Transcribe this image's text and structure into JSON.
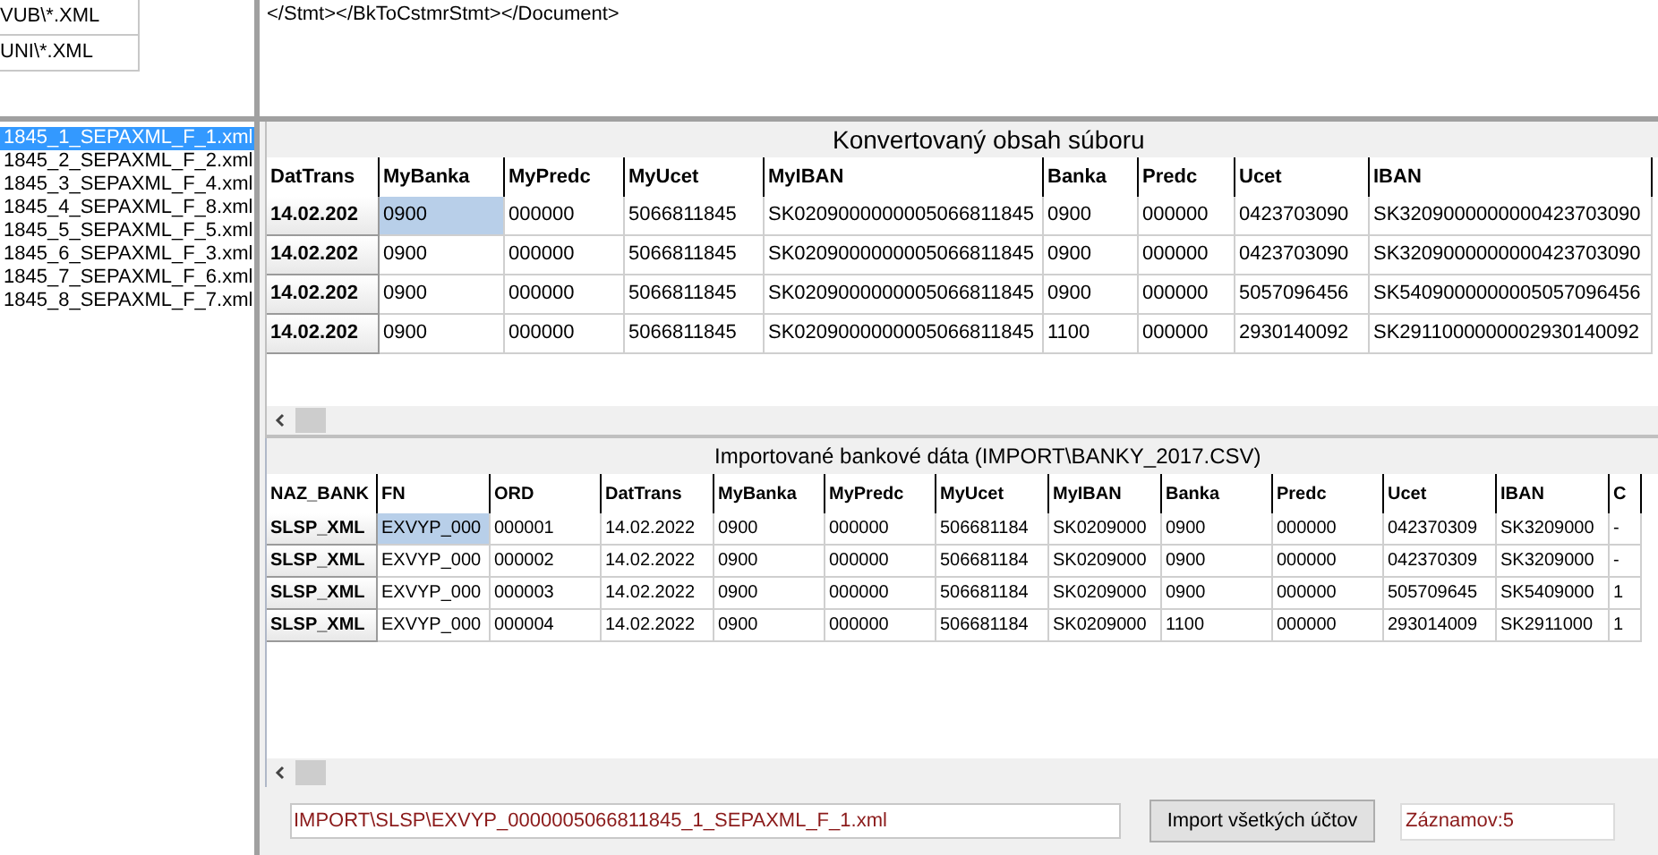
{
  "masks": [
    {
      "text": "VUB\\*.XML"
    },
    {
      "text": "UNI\\*.XML"
    }
  ],
  "xml_preview": {
    "text": "</Stmt></BkToCstmrStmt></Document>"
  },
  "files": [
    {
      "name": "1845_1_SEPAXML_F_1.xml",
      "selected": true
    },
    {
      "name": "1845_2_SEPAXML_F_2.xml",
      "selected": false
    },
    {
      "name": "1845_3_SEPAXML_F_4.xml",
      "selected": false
    },
    {
      "name": "1845_4_SEPAXML_F_8.xml",
      "selected": false
    },
    {
      "name": "1845_5_SEPAXML_F_5.xml",
      "selected": false
    },
    {
      "name": "1845_6_SEPAXML_F_3.xml",
      "selected": false
    },
    {
      "name": "1845_7_SEPAXML_F_6.xml",
      "selected": false
    },
    {
      "name": "1845_8_SEPAXML_F_7.xml",
      "selected": false
    }
  ],
  "converted": {
    "title": "Konvertovaný obsah súboru",
    "columns": [
      "DatTrans",
      "MyBanka",
      "MyPredc",
      "MyUcet",
      "MyIBAN",
      "Banka",
      "Predc",
      "Ucet",
      "IBAN"
    ],
    "rows": [
      {
        "cells": [
          {
            "text": "14.02.202",
            "selected": false
          },
          {
            "text": "0900",
            "selected": true
          },
          {
            "text": "000000",
            "selected": false
          },
          {
            "text": "5066811845",
            "selected": false
          },
          {
            "text": "SK0209000000005066811845",
            "selected": false
          },
          {
            "text": "0900",
            "selected": false
          },
          {
            "text": "000000",
            "selected": false
          },
          {
            "text": "0423703090",
            "selected": false
          },
          {
            "text": "SK3209000000000423703090",
            "selected": false
          }
        ]
      },
      {
        "cells": [
          {
            "text": "14.02.202",
            "selected": false
          },
          {
            "text": "0900",
            "selected": false
          },
          {
            "text": "000000",
            "selected": false
          },
          {
            "text": "5066811845",
            "selected": false
          },
          {
            "text": "SK0209000000005066811845",
            "selected": false
          },
          {
            "text": "0900",
            "selected": false
          },
          {
            "text": "000000",
            "selected": false
          },
          {
            "text": "0423703090",
            "selected": false
          },
          {
            "text": "SK3209000000000423703090",
            "selected": false
          }
        ]
      },
      {
        "cells": [
          {
            "text": "14.02.202",
            "selected": false
          },
          {
            "text": "0900",
            "selected": false
          },
          {
            "text": "000000",
            "selected": false
          },
          {
            "text": "5066811845",
            "selected": false
          },
          {
            "text": "SK0209000000005066811845",
            "selected": false
          },
          {
            "text": "0900",
            "selected": false
          },
          {
            "text": "000000",
            "selected": false
          },
          {
            "text": "5057096456",
            "selected": false
          },
          {
            "text": "SK5409000000005057096456",
            "selected": false
          }
        ]
      },
      {
        "cells": [
          {
            "text": "14.02.202",
            "selected": false
          },
          {
            "text": "0900",
            "selected": false
          },
          {
            "text": "000000",
            "selected": false
          },
          {
            "text": "5066811845",
            "selected": false
          },
          {
            "text": "SK0209000000005066811845",
            "selected": false
          },
          {
            "text": "1100",
            "selected": false
          },
          {
            "text": "000000",
            "selected": false
          },
          {
            "text": "2930140092",
            "selected": false
          },
          {
            "text": "SK2911000000002930140092",
            "selected": false
          }
        ]
      }
    ]
  },
  "imported": {
    "title": "Importované bankové dáta  (IMPORT\\BANKY_2017.CSV)",
    "columns": [
      "NAZ_BANK",
      "FN",
      "ORD",
      "DatTrans",
      "MyBanka",
      "MyPredc",
      "MyUcet",
      "MyIBAN",
      "Banka",
      "Predc",
      "Ucet",
      "IBAN",
      "C"
    ],
    "rows": [
      {
        "cells": [
          {
            "text": "SLSP_XML",
            "selected": false
          },
          {
            "text": "EXVYP_000",
            "selected": true
          },
          {
            "text": "000001",
            "selected": false
          },
          {
            "text": "14.02.2022",
            "selected": false
          },
          {
            "text": "0900",
            "selected": false
          },
          {
            "text": "000000",
            "selected": false
          },
          {
            "text": "506681184",
            "selected": false
          },
          {
            "text": "SK0209000",
            "selected": false
          },
          {
            "text": "0900",
            "selected": false
          },
          {
            "text": "000000",
            "selected": false
          },
          {
            "text": "042370309",
            "selected": false
          },
          {
            "text": "SK3209000",
            "selected": false
          },
          {
            "text": "-",
            "selected": false
          }
        ]
      },
      {
        "cells": [
          {
            "text": "SLSP_XML",
            "selected": false
          },
          {
            "text": "EXVYP_000",
            "selected": false
          },
          {
            "text": "000002",
            "selected": false
          },
          {
            "text": "14.02.2022",
            "selected": false
          },
          {
            "text": "0900",
            "selected": false
          },
          {
            "text": "000000",
            "selected": false
          },
          {
            "text": "506681184",
            "selected": false
          },
          {
            "text": "SK0209000",
            "selected": false
          },
          {
            "text": "0900",
            "selected": false
          },
          {
            "text": "000000",
            "selected": false
          },
          {
            "text": "042370309",
            "selected": false
          },
          {
            "text": "SK3209000",
            "selected": false
          },
          {
            "text": "-",
            "selected": false
          }
        ]
      },
      {
        "cells": [
          {
            "text": "SLSP_XML",
            "selected": false
          },
          {
            "text": "EXVYP_000",
            "selected": false
          },
          {
            "text": "000003",
            "selected": false
          },
          {
            "text": "14.02.2022",
            "selected": false
          },
          {
            "text": "0900",
            "selected": false
          },
          {
            "text": "000000",
            "selected": false
          },
          {
            "text": "506681184",
            "selected": false
          },
          {
            "text": "SK0209000",
            "selected": false
          },
          {
            "text": "0900",
            "selected": false
          },
          {
            "text": "000000",
            "selected": false
          },
          {
            "text": "505709645",
            "selected": false
          },
          {
            "text": "SK5409000",
            "selected": false
          },
          {
            "text": "1",
            "selected": false
          }
        ]
      },
      {
        "cells": [
          {
            "text": "SLSP_XML",
            "selected": false
          },
          {
            "text": "EXVYP_000",
            "selected": false
          },
          {
            "text": "000004",
            "selected": false
          },
          {
            "text": "14.02.2022",
            "selected": false
          },
          {
            "text": "0900",
            "selected": false
          },
          {
            "text": "000000",
            "selected": false
          },
          {
            "text": "506681184",
            "selected": false
          },
          {
            "text": "SK0209000",
            "selected": false
          },
          {
            "text": "1100",
            "selected": false
          },
          {
            "text": "000000",
            "selected": false
          },
          {
            "text": "293014009",
            "selected": false
          },
          {
            "text": "SK2911000",
            "selected": false
          },
          {
            "text": "1",
            "selected": false
          }
        ]
      }
    ]
  },
  "bottom": {
    "path": "IMPORT\\SLSP\\EXVYP_0000005066811845_1_SEPAXML_F_1.xml",
    "import_button": "Import všetkých účtov",
    "count": "Záznamov:5"
  }
}
